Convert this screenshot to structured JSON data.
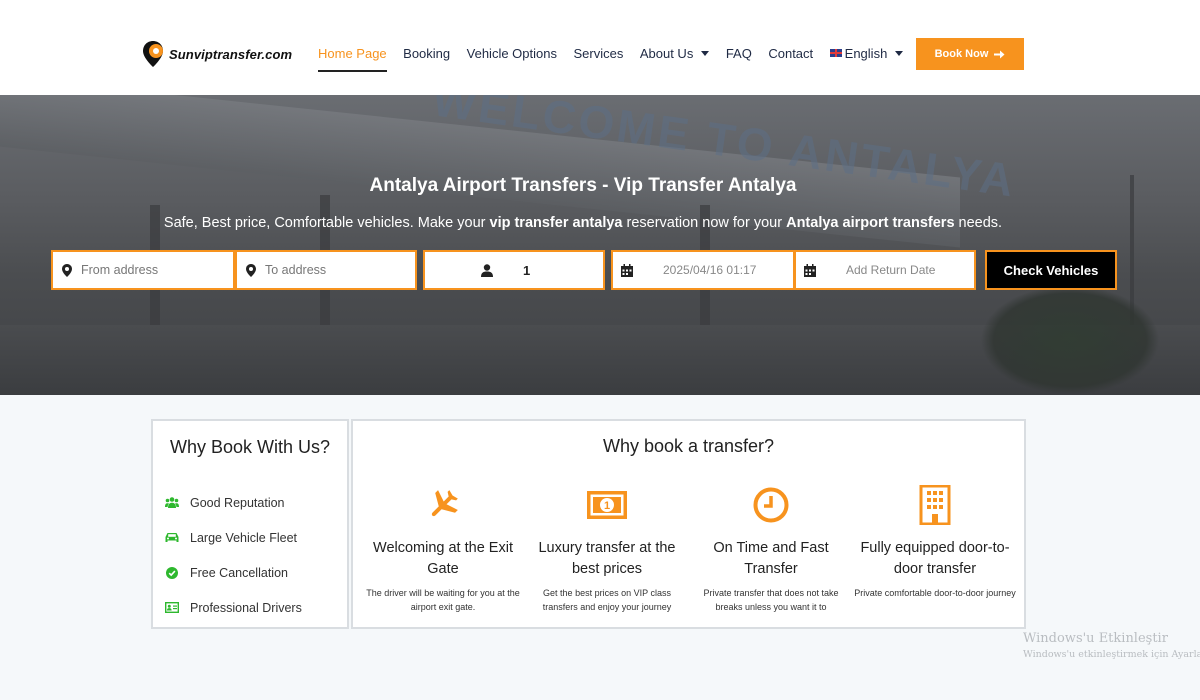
{
  "brand": {
    "name": "Sunviptransfer.com",
    "accent": "#f7931e"
  },
  "nav": {
    "items": [
      {
        "label": "Home Page",
        "active": true
      },
      {
        "label": "Booking"
      },
      {
        "label": "Vehicle Options"
      },
      {
        "label": "Services"
      },
      {
        "label": "About Us",
        "dropdown": true
      },
      {
        "label": "FAQ"
      },
      {
        "label": "Contact"
      },
      {
        "label": "English",
        "dropdown": true,
        "flag": "uk-flag-icon"
      }
    ],
    "book_now": "Book Now"
  },
  "hero": {
    "title": "Antalya Airport Transfers - Vip Transfer Antalya",
    "subtitle_parts": [
      "Safe, Best price, Comfortable vehicles. Make your ",
      "vip transfer antalya",
      " reservation now for your ",
      "Antalya airport transfers",
      " needs."
    ],
    "background_sign": "WELCOME TO ANTALYA"
  },
  "search": {
    "from_placeholder": "From address",
    "to_placeholder": "To address",
    "passengers": "1",
    "date_value": "2025/04/16 01:17",
    "return_placeholder": "Add Return Date",
    "button": "Check Vehicles"
  },
  "why_us": {
    "title": "Why Book With Us?",
    "items": [
      {
        "label": "Good Reputation",
        "icon": "users-icon"
      },
      {
        "label": "Large Vehicle Fleet",
        "icon": "car-icon"
      },
      {
        "label": "Free Cancellation",
        "icon": "check-circle-icon"
      },
      {
        "label": "Professional Drivers",
        "icon": "id-card-icon"
      }
    ],
    "icon_color": "#2eb82e"
  },
  "why_transfer": {
    "title": "Why book a transfer?",
    "features": [
      {
        "title": "Welcoming at the Exit Gate",
        "desc": "The driver will be waiting for you at the airport exit gate.",
        "icon": "plane-icon"
      },
      {
        "title": "Luxury transfer at the best prices",
        "desc": "Get the best prices on VIP class transfers and enjoy your journey",
        "icon": "money-bill-icon"
      },
      {
        "title": "On Time and Fast Transfer",
        "desc": "Private transfer that does not take breaks unless you want it to",
        "icon": "clock-icon"
      },
      {
        "title": "Fully equipped door-to-door transfer",
        "desc": "Private comfortable door-to-door journey",
        "icon": "building-icon"
      }
    ]
  },
  "watermark": {
    "line1": "Windows'u Etkinleştir",
    "line2": "Windows'u etkinleştirmek için Ayarlar'a gidin."
  }
}
